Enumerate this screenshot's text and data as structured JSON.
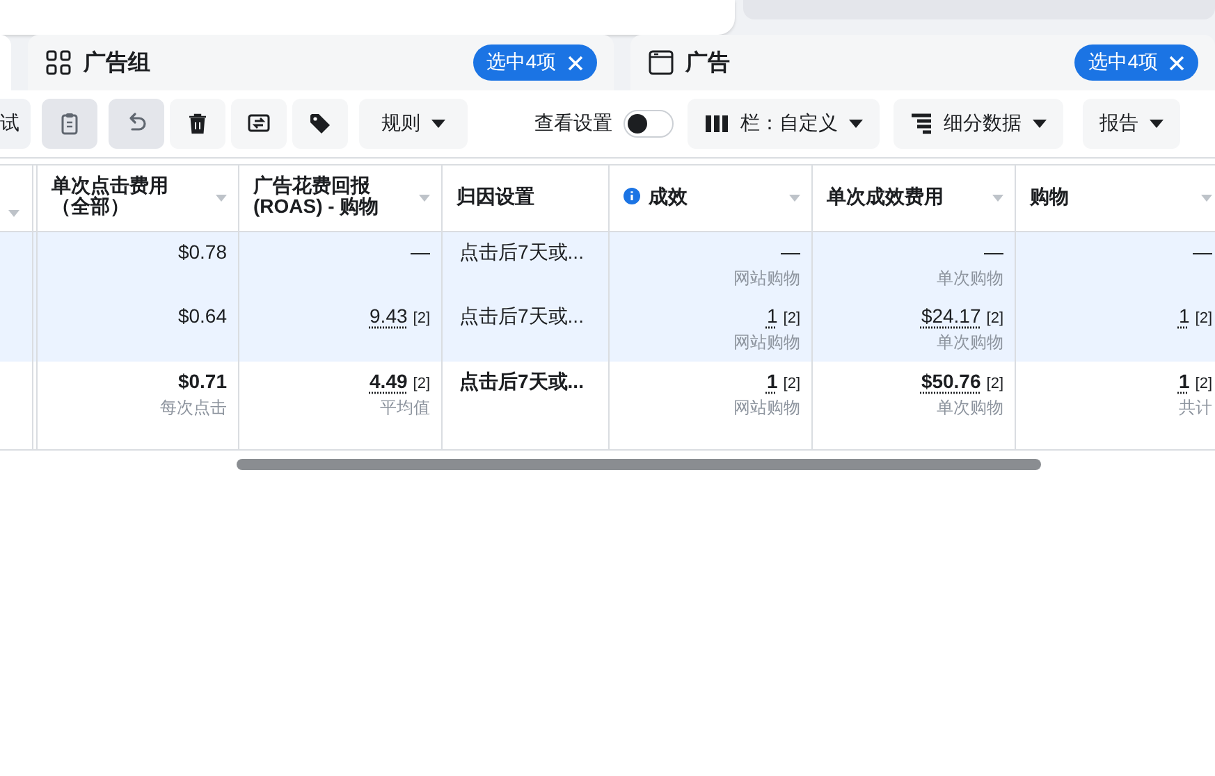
{
  "panels": [
    {
      "title": "广告组",
      "badge": "选中4项"
    },
    {
      "title": "广告",
      "badge": "选中4项"
    }
  ],
  "toolbar": {
    "cut_label": "试",
    "icon_buttons": [
      {
        "kind": "clipboard",
        "disabled": true
      },
      {
        "kind": "undo",
        "disabled": true
      },
      {
        "kind": "trash",
        "disabled": false
      },
      {
        "kind": "swap",
        "disabled": false
      },
      {
        "kind": "tag",
        "disabled": false
      }
    ],
    "rules": "规则",
    "view_settings": {
      "label": "查看设置",
      "on": false
    },
    "columns": "栏：自定义",
    "breakdown": "细分数据",
    "report": "报告"
  },
  "table": {
    "columns": [
      {
        "label": "单次点击费用（全部）",
        "sortable": true,
        "info": false
      },
      {
        "label": "广告花费回报 (ROAS) - 购物",
        "sortable": true,
        "info": false
      },
      {
        "label": "归因设置",
        "sortable": false,
        "info": false
      },
      {
        "label": "成效",
        "sortable": true,
        "info": true
      },
      {
        "label": "单次成效费用",
        "sortable": true,
        "info": false
      },
      {
        "label": "购物",
        "sortable": true,
        "info": false
      }
    ],
    "rows": [
      {
        "kind": "item",
        "selected": true,
        "cells": [
          {
            "value": "$0.78"
          },
          {
            "value": "—"
          },
          {
            "value": "点击后7天或..."
          },
          {
            "value": "—",
            "sub": "网站购物"
          },
          {
            "value": "—",
            "sub": "单次购物"
          },
          {
            "value": "—"
          }
        ]
      },
      {
        "kind": "item",
        "selected": true,
        "cells": [
          {
            "value": "$0.64"
          },
          {
            "value": "9.43",
            "note": "[2]"
          },
          {
            "value": "点击后7天或..."
          },
          {
            "value": "1",
            "note": "[2]",
            "sub": "网站购物"
          },
          {
            "value": "$24.17",
            "note": "[2]",
            "sub": "单次购物"
          },
          {
            "value": "1",
            "note": "[2]"
          }
        ]
      },
      {
        "kind": "total",
        "selected": false,
        "cells": [
          {
            "value": "$0.71",
            "sub": "每次点击"
          },
          {
            "value": "4.49",
            "note": "[2]",
            "sub": "平均值"
          },
          {
            "value": "点击后7天或..."
          },
          {
            "value": "1",
            "note": "[2]",
            "sub": "网站购物"
          },
          {
            "value": "$50.76",
            "note": "[2]",
            "sub": "单次购物"
          },
          {
            "value": "1",
            "note": "[2]",
            "sub": "共计"
          }
        ]
      }
    ]
  }
}
